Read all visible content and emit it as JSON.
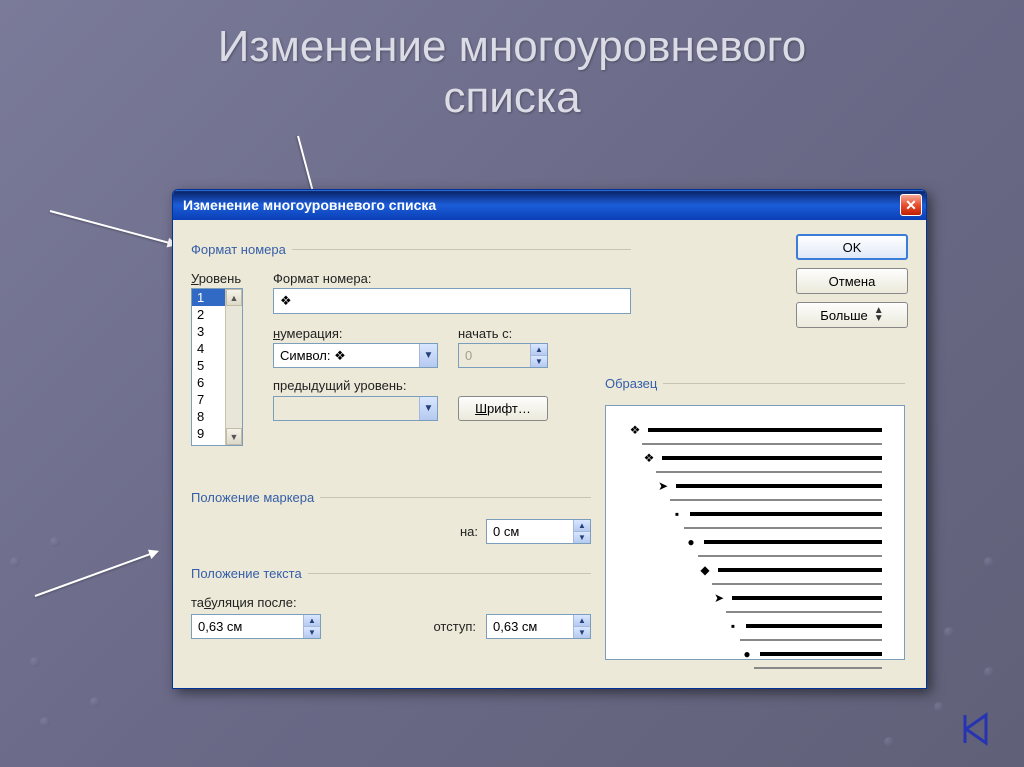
{
  "slide": {
    "title_line1": "Изменение многоуровневого",
    "title_line2": "списка"
  },
  "dialog": {
    "title": "Изменение многоуровневого списка",
    "close_symbol": "✕",
    "buttons": {
      "ok": "OK",
      "cancel": "Отмена",
      "more": "Больше"
    },
    "groups": {
      "format": "Формат номера",
      "marker": "Положение маркера",
      "text": "Положение текста",
      "preview": "Образец"
    },
    "labels": {
      "level": "Уровень",
      "level_ul": "У",
      "number_format": "Формат номера:",
      "numbering": "нумерация:",
      "start_at": "начать с:",
      "prev_level": "предыдущий уровень:",
      "font": "Шрифт…",
      "at": "на:",
      "tab_after": "табуляция после:",
      "tab_ul": "б",
      "indent": "отступ:"
    },
    "values": {
      "levels": [
        "1",
        "2",
        "3",
        "4",
        "5",
        "6",
        "7",
        "8",
        "9"
      ],
      "selected_level": "1",
      "format_bullet": "❖",
      "numbering_value": "Символ: ❖",
      "start_at_value": "0",
      "prev_value": "",
      "marker_at": "0 см",
      "tab_after": "0,63 см",
      "indent": "0,63 см"
    },
    "preview": {
      "bullets": [
        "❖",
        "❖",
        "➤",
        "▪",
        "●",
        "◆",
        "➤",
        "▪",
        "●"
      ],
      "indents": [
        0,
        14,
        28,
        42,
        56,
        70,
        84,
        98,
        112
      ]
    }
  }
}
